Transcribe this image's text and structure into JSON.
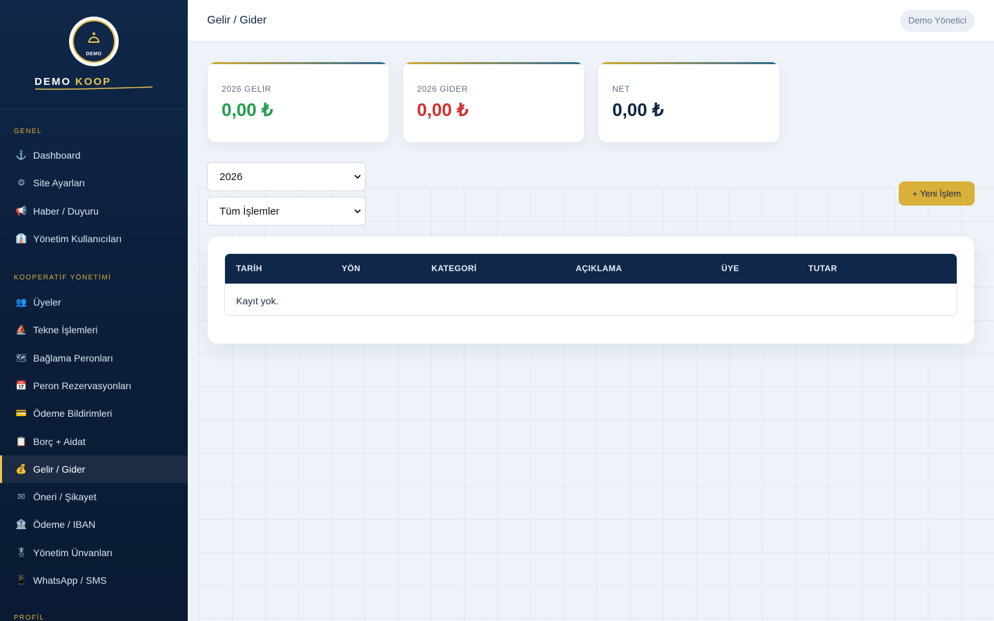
{
  "sidebar": {
    "logo_text": "DEMO",
    "brand_primary": "DEMO",
    "brand_accent": "KOOP",
    "sections": [
      {
        "title": "GENEL",
        "items": [
          {
            "icon": "anchor-icon",
            "glyph": "⚓",
            "label": "Dashboard"
          },
          {
            "icon": "gear-icon",
            "glyph": "⚙",
            "label": "Site Ayarları"
          },
          {
            "icon": "megaphone-icon",
            "glyph": "📢",
            "label": "Haber / Duyuru"
          },
          {
            "icon": "admin-user-icon",
            "glyph": "👔",
            "label": "Yönetim Kullanıcıları"
          }
        ]
      },
      {
        "title": "KOOPERATİF YÖNETİMİ",
        "items": [
          {
            "icon": "members-icon",
            "glyph": "👥",
            "label": "Üyeler"
          },
          {
            "icon": "boat-icon",
            "glyph": "⛵",
            "label": "Tekne İşlemleri"
          },
          {
            "icon": "map-icon",
            "glyph": "🗺",
            "label": "Bağlama Peronları"
          },
          {
            "icon": "calendar-icon",
            "glyph": "📅",
            "label": "Peron Rezervasyonları"
          },
          {
            "icon": "credit-card-icon",
            "glyph": "💳",
            "label": "Ödeme Bildirimleri"
          },
          {
            "icon": "clipboard-icon",
            "glyph": "📋",
            "label": "Borç + Aidat"
          },
          {
            "icon": "money-bag-icon",
            "glyph": "💰",
            "label": "Gelir / Gider",
            "active": true
          },
          {
            "icon": "envelope-icon",
            "glyph": "✉",
            "label": "Öneri / Şikayet"
          },
          {
            "icon": "bank-icon",
            "glyph": "🏦",
            "label": "Ödeme / IBAN"
          },
          {
            "icon": "medal-icon",
            "glyph": "🎖",
            "label": "Yönetim Ünvanları"
          },
          {
            "icon": "phone-icon",
            "glyph": "📱",
            "label": "WhatsApp / SMS"
          }
        ]
      },
      {
        "title": "PROFİL",
        "items": []
      }
    ]
  },
  "header": {
    "title": "Gelir / Gider",
    "user": "Demo Yönetici"
  },
  "stats": [
    {
      "label": "2026 GELİR",
      "value": "0,00 ₺",
      "color": "#1f9d4c"
    },
    {
      "label": "2026 GİDER",
      "value": "0,00 ₺",
      "color": "#d32f2f"
    },
    {
      "label": "NET",
      "value": "0,00 ₺",
      "color": "#0f2340"
    }
  ],
  "filters": {
    "year": "2026",
    "type": "Tüm İşlemler"
  },
  "actions": {
    "new_label": "+ Yeni İşlem"
  },
  "table": {
    "columns": [
      "TARİH",
      "YÖN",
      "KATEGORİ",
      "AÇIKLAMA",
      "ÜYE",
      "TUTAR"
    ],
    "empty_text": "Kayıt yok."
  },
  "colors": {
    "sidebar_bg": "#0f2748",
    "accent_gold": "#d8b03a",
    "income_green": "#1f9d4c",
    "expense_red": "#d32f2f"
  }
}
